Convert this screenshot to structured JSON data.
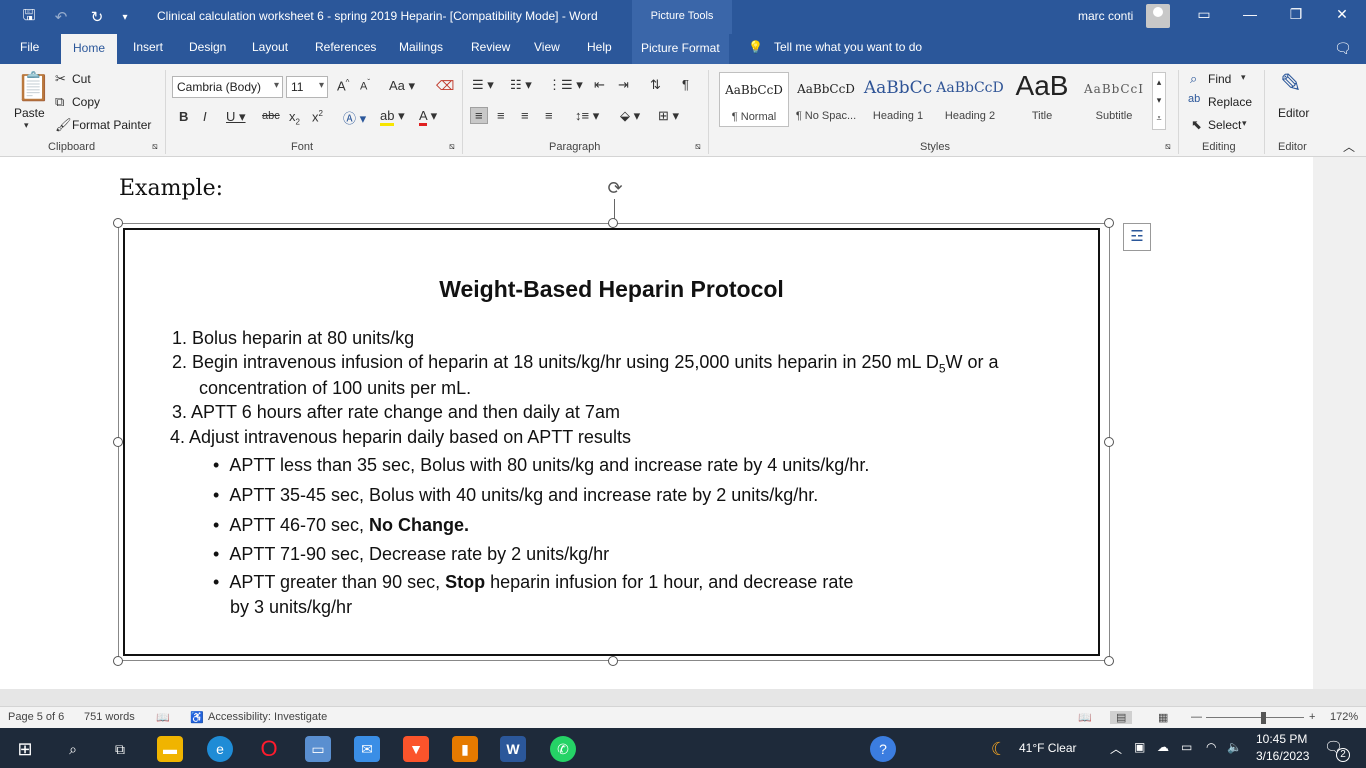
{
  "titlebar": {
    "title": "Clinical calculation worksheet 6 - spring 2019 Heparin-  [Compatibility Mode]  -  Word",
    "context_tab": "Picture Tools",
    "user": "marc conti"
  },
  "tabs": [
    "File",
    "Home",
    "Insert",
    "Design",
    "Layout",
    "References",
    "Mailings",
    "Review",
    "View",
    "Help",
    "Picture Format"
  ],
  "tell_me": "Tell me what you want to do",
  "clipboard": {
    "paste": "Paste",
    "cut": "Cut",
    "copy": "Copy",
    "format_painter": "Format Painter",
    "group": "Clipboard"
  },
  "font": {
    "name": "Cambria (Body)",
    "size": "11",
    "group": "Font"
  },
  "paragraph": {
    "group": "Paragraph"
  },
  "styles": {
    "group": "Styles",
    "items": [
      {
        "sample": "AaBbCcD",
        "name": "¶ Normal"
      },
      {
        "sample": "AaBbCcD",
        "name": "¶ No Spac..."
      },
      {
        "sample": "AaBbCc",
        "name": "Heading 1"
      },
      {
        "sample": "AaBbCcD",
        "name": "Heading 2"
      },
      {
        "sample": "AaB",
        "name": "Title"
      },
      {
        "sample": "AaBbCcI",
        "name": "Subtitle"
      }
    ]
  },
  "editing": {
    "find": "Find",
    "replace": "Replace",
    "select": "Select",
    "group": "Editing"
  },
  "editor": {
    "label": "Editor",
    "group": "Editor"
  },
  "document": {
    "example": "Example:",
    "protocol_title": "Weight-Based Heparin Protocol",
    "items": [
      "1.  Bolus heparin at 80 units/kg",
      "2.  Begin intravenous infusion of heparin at 18 units/kg/hr using 25,000 units heparin in 250 mL D",
      "concentration of 100 units per mL.",
      "3.  APTT 6 hours after rate change and then daily at 7am",
      "4.  Adjust intravenous heparin daily based on APTT results"
    ],
    "d5w_sub": "5",
    "d5w_tail": "W or a",
    "bullets": {
      "b1": "APTT less than 35 sec, Bolus with 80 units/kg and increase rate by 4 units/kg/hr.",
      "b2": "APTT 35-45 sec, Bolus with 40 units/kg and increase rate by 2 units/kg/hr.",
      "b3_pre": "APTT 46-70 sec, ",
      "b3_bold": "No Change.",
      "b4": "APTT 71-90 sec, Decrease rate by 2 units/kg/hr",
      "b5_pre": "APTT greater than 90 sec, ",
      "b5_bold": "Stop",
      "b5_post": " heparin infusion for 1 hour, and decrease rate",
      "b5_line2": "by 3 units/kg/hr"
    }
  },
  "status": {
    "page": "Page 5 of 6",
    "words": "751 words",
    "accessibility": "Accessibility: Investigate",
    "zoom": "172%"
  },
  "taskbar": {
    "weather": "41°F  Clear",
    "time": "10:45 PM",
    "date": "3/16/2023",
    "notifications": "2"
  }
}
